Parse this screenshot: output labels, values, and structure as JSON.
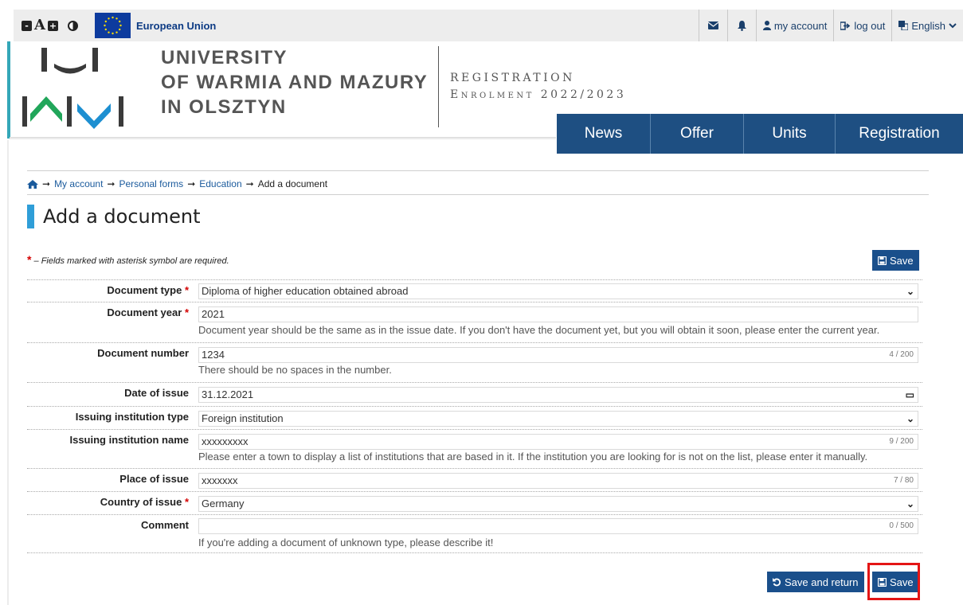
{
  "topbar": {
    "font_a": "A",
    "minus": "-",
    "plus": "+",
    "eu_label": "European Union",
    "messages_icon": "envelope-icon",
    "notifications_icon": "bell-icon",
    "my_account": "my account",
    "log_out": "log out",
    "language": "English"
  },
  "header": {
    "uni_line1": "UNIVERSITY",
    "uni_line2": "OF WARMIA AND MAZURY",
    "uni_line3": "IN OLSZTYN",
    "reg_line1": "REGISTRATION",
    "reg_line2": "Enrolment 2022/2023",
    "logo_colors": {
      "dark": "#3a3a3a",
      "green": "#21a65a",
      "blue": "#1d8fd1"
    }
  },
  "nav": {
    "items": [
      {
        "label": "News"
      },
      {
        "label": "Offer"
      },
      {
        "label": "Units"
      },
      {
        "label": "Registration"
      }
    ]
  },
  "breadcrumb": {
    "home_icon": "home-icon",
    "items": [
      "My account",
      "Personal forms",
      "Education"
    ],
    "current": "Add a document"
  },
  "page": {
    "title": "Add a document",
    "required_note": "– Fields marked with asterisk symbol are required.",
    "save_label": "Save",
    "save_and_return_label": "Save and return"
  },
  "form": {
    "document_type": {
      "label": "Document type",
      "value": "Diploma of higher education obtained abroad"
    },
    "document_year": {
      "label": "Document year",
      "value": "2021",
      "hint": "Document year should be the same as in the issue date. If you don't have the document yet, but you will obtain it soon, please enter the current year."
    },
    "document_number": {
      "label": "Document number",
      "value": "1234",
      "counter": "4 / 200",
      "hint": "There should be no spaces in the number."
    },
    "date_of_issue": {
      "label": "Date of issue",
      "value": "31.12.2021"
    },
    "issuing_institution_type": {
      "label": "Issuing institution type",
      "value": "Foreign institution"
    },
    "issuing_institution_name": {
      "label": "Issuing institution name",
      "value": "xxxxxxxxx",
      "counter": "9 / 200",
      "hint": "Please enter a town to display a list of institutions that are based in it. If the institution you are looking for is not on the list, please enter it manually."
    },
    "place_of_issue": {
      "label": "Place of issue",
      "value": "xxxxxxx",
      "counter": "7 / 80"
    },
    "country_of_issue": {
      "label": "Country of issue",
      "value": "Germany"
    },
    "comment": {
      "label": "Comment",
      "value": "",
      "counter": "0 / 500",
      "hint": "If you're adding a document of unknown type, please describe it!"
    }
  },
  "colors": {
    "accent": "#1a4f8b",
    "nav": "#1e4f82",
    "required": "#d40000",
    "highlight": "#e41515",
    "title_bar": "#2f9ed8"
  }
}
